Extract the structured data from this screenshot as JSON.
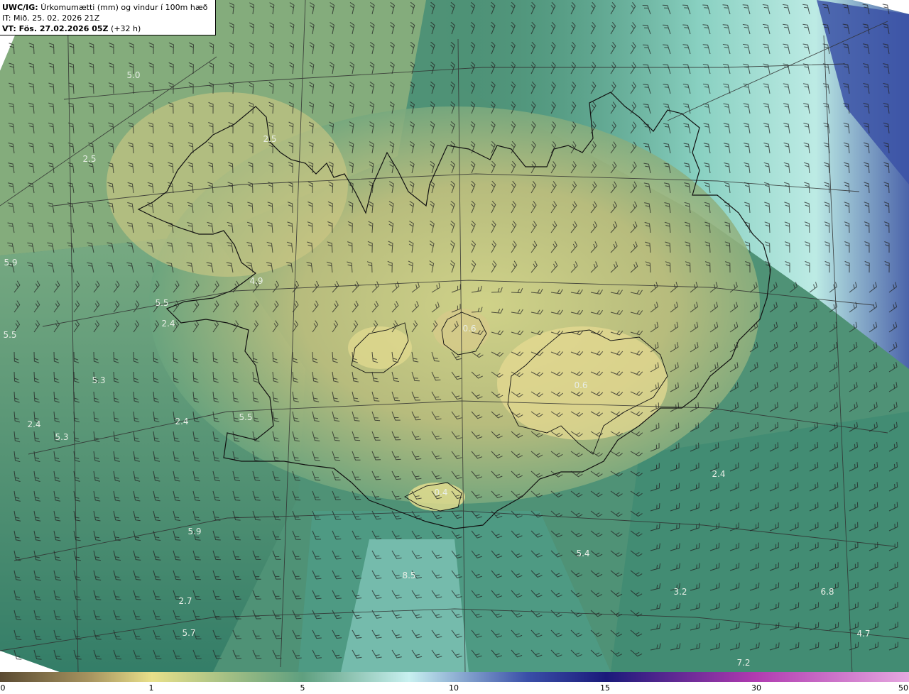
{
  "title": {
    "product": "UWC/IG:",
    "variable": "Úrkomumætti (mm) og vindur í 100m hæð",
    "init_time": "IT: Mið. 25. 02. 2026 21Z",
    "valid_prefix": "VT: Fös. 27.02.2026 05Z",
    "lead": "(+32 h)"
  },
  "colorbar": {
    "ticks": [
      "0",
      "1",
      "5",
      "10",
      "15",
      "30",
      "50"
    ],
    "colors": [
      "#5a4a32",
      "#a89560",
      "#e8e08a",
      "#5f9f7f",
      "#c8f0f0",
      "#3a4fa8",
      "#1a1a7a",
      "#b03ab0",
      "#e6a8e0"
    ]
  },
  "map_labels": [
    {
      "text": "5.0"
    },
    {
      "text": "2.5"
    },
    {
      "text": "5.9"
    },
    {
      "text": "5.5"
    },
    {
      "text": "5.5"
    },
    {
      "text": "2.4"
    },
    {
      "text": "4.9"
    },
    {
      "text": "5.3"
    },
    {
      "text": "2.4"
    },
    {
      "text": "5.3"
    },
    {
      "text": "2.4"
    },
    {
      "text": "5.5"
    },
    {
      "text": "5.9"
    },
    {
      "text": "2.7"
    },
    {
      "text": "5.7"
    },
    {
      "text": "0.6"
    },
    {
      "text": "0.6"
    },
    {
      "text": "5.4"
    },
    {
      "text": "8.5"
    },
    {
      "text": "3.2"
    },
    {
      "text": "6.8"
    },
    {
      "text": "4.7"
    },
    {
      "text": "7.2"
    },
    {
      "text": "2.4"
    },
    {
      "text": "0.4"
    },
    {
      "text": "2.5"
    }
  ]
}
